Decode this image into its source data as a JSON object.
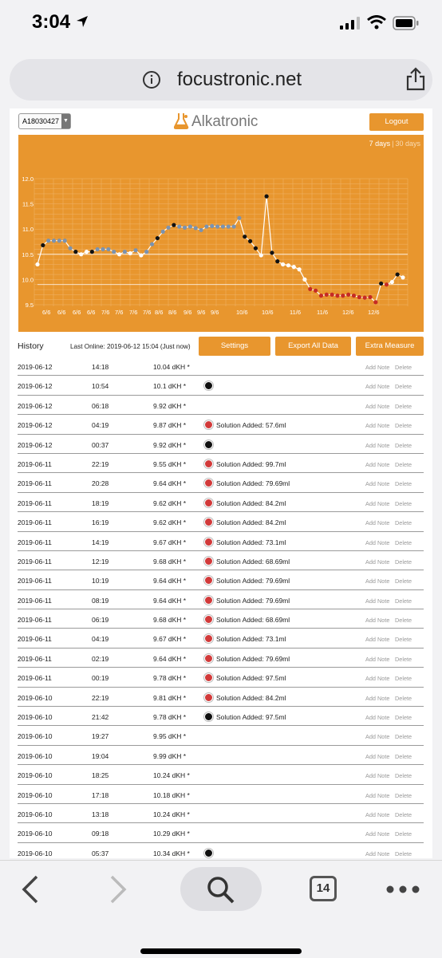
{
  "status_bar": {
    "time": "3:04"
  },
  "address_bar": {
    "url": "focustronic.net"
  },
  "header": {
    "device_id": "A18030427",
    "brand": "Alkatronic",
    "logout_label": "Logout"
  },
  "chart_data": {
    "type": "line",
    "range_options": [
      "7 days",
      "30 days"
    ],
    "selected_range": "7 days",
    "x_tick_labels": [
      "6/6",
      "6/6",
      "6/6",
      "6/6",
      "7/6",
      "7/6",
      "7/6",
      "7/6",
      "8/6",
      "8/6",
      "9/6",
      "9/6",
      "9/6",
      "10/6",
      "10/6",
      "11/6",
      "11/6",
      "12/6",
      "12/6"
    ],
    "ylim": [
      9.5,
      12.0
    ],
    "y_ticks": [
      9.5,
      10.0,
      10.5,
      11.0,
      11.5,
      12.0
    ],
    "values": [
      10.3,
      10.68,
      10.77,
      10.77,
      10.77,
      10.77,
      10.62,
      10.55,
      10.5,
      10.55,
      10.55,
      10.6,
      10.6,
      10.6,
      10.55,
      10.5,
      10.55,
      10.52,
      10.58,
      10.48,
      10.55,
      10.7,
      10.82,
      10.95,
      11.03,
      11.08,
      11.05,
      11.03,
      11.05,
      11.02,
      10.98,
      11.05,
      11.06,
      11.05,
      11.05,
      11.05,
      11.05,
      11.22,
      10.85,
      10.76,
      10.62,
      10.48,
      11.65,
      10.53,
      10.36,
      10.3,
      10.28,
      10.25,
      10.2,
      10.0,
      9.81,
      9.78,
      9.68,
      9.7,
      9.7,
      9.68,
      9.68,
      9.7,
      9.68,
      9.65,
      9.64,
      9.65,
      9.55,
      9.92,
      9.9,
      9.95,
      10.1,
      10.04
    ],
    "point_colors": [
      "white",
      "black",
      "blue",
      "blue",
      "blue",
      "blue",
      "blue",
      "black",
      "white",
      "white",
      "black",
      "blue",
      "blue",
      "blue",
      "blue",
      "white",
      "blue",
      "white",
      "blue",
      "white",
      "blue",
      "blue",
      "black",
      "blue",
      "blue",
      "black",
      "blue",
      "blue",
      "blue",
      "blue",
      "blue",
      "blue",
      "blue",
      "blue",
      "blue",
      "blue",
      "blue",
      "blue",
      "black",
      "black",
      "black",
      "white",
      "black",
      "black",
      "black",
      "white",
      "white",
      "white",
      "white",
      "white",
      "red",
      "red",
      "red",
      "red",
      "red",
      "red",
      "red",
      "red",
      "red",
      "red",
      "red",
      "red",
      "red",
      "black",
      "red",
      "white",
      "black",
      "white"
    ],
    "colors": {
      "background": "#e8962e",
      "line": "#ffffff",
      "blue": "#7b93b0",
      "black": "#111111",
      "white": "#ffffff",
      "red": "#c52b25"
    }
  },
  "history": {
    "title": "History",
    "last_online": "Last Online: 2019-06-12 15:04 (Just now)",
    "settings_label": "Settings",
    "export_label": "Export All Data",
    "extra_label": "Extra Measure",
    "add_note_label": "Add Note",
    "delete_label": "Delete",
    "rows": [
      {
        "date": "2019-06-12",
        "time": "14:18",
        "value": "10.04 dKH *",
        "dot": "",
        "note": ""
      },
      {
        "date": "2019-06-12",
        "time": "10:54",
        "value": "10.1 dKH *",
        "dot": "black",
        "note": ""
      },
      {
        "date": "2019-06-12",
        "time": "06:18",
        "value": "9.92 dKH *",
        "dot": "",
        "note": ""
      },
      {
        "date": "2019-06-12",
        "time": "04:19",
        "value": "9.87 dKH *",
        "dot": "red",
        "note": "Solution Added: 57.6ml"
      },
      {
        "date": "2019-06-12",
        "time": "00:37",
        "value": "9.92 dKH *",
        "dot": "black",
        "note": ""
      },
      {
        "date": "2019-06-11",
        "time": "22:19",
        "value": "9.55 dKH *",
        "dot": "red",
        "note": "Solution Added: 99.7ml"
      },
      {
        "date": "2019-06-11",
        "time": "20:28",
        "value": "9.64 dKH *",
        "dot": "red",
        "note": "Solution Added: 79.69ml"
      },
      {
        "date": "2019-06-11",
        "time": "18:19",
        "value": "9.62 dKH *",
        "dot": "red",
        "note": "Solution Added: 84.2ml"
      },
      {
        "date": "2019-06-11",
        "time": "16:19",
        "value": "9.62 dKH *",
        "dot": "red",
        "note": "Solution Added: 84.2ml"
      },
      {
        "date": "2019-06-11",
        "time": "14:19",
        "value": "9.67 dKH *",
        "dot": "red",
        "note": "Solution Added: 73.1ml"
      },
      {
        "date": "2019-06-11",
        "time": "12:19",
        "value": "9.68 dKH *",
        "dot": "red",
        "note": "Solution Added: 68.69ml"
      },
      {
        "date": "2019-06-11",
        "time": "10:19",
        "value": "9.64 dKH *",
        "dot": "red",
        "note": "Solution Added: 79.69ml"
      },
      {
        "date": "2019-06-11",
        "time": "08:19",
        "value": "9.64 dKH *",
        "dot": "red",
        "note": "Solution Added: 79.69ml"
      },
      {
        "date": "2019-06-11",
        "time": "06:19",
        "value": "9.68 dKH *",
        "dot": "red",
        "note": "Solution Added: 68.69ml"
      },
      {
        "date": "2019-06-11",
        "time": "04:19",
        "value": "9.67 dKH *",
        "dot": "red",
        "note": "Solution Added: 73.1ml"
      },
      {
        "date": "2019-06-11",
        "time": "02:19",
        "value": "9.64 dKH *",
        "dot": "red",
        "note": "Solution Added: 79.69ml"
      },
      {
        "date": "2019-06-11",
        "time": "00:19",
        "value": "9.78 dKH *",
        "dot": "red",
        "note": "Solution Added: 97.5ml"
      },
      {
        "date": "2019-06-10",
        "time": "22:19",
        "value": "9.81 dKH *",
        "dot": "red",
        "note": "Solution Added: 84.2ml"
      },
      {
        "date": "2019-06-10",
        "time": "21:42",
        "value": "9.78 dKH *",
        "dot": "black",
        "note": "Solution Added: 97.5ml"
      },
      {
        "date": "2019-06-10",
        "time": "19:27",
        "value": "9.95 dKH *",
        "dot": "",
        "note": ""
      },
      {
        "date": "2019-06-10",
        "time": "19:04",
        "value": "9.99 dKH *",
        "dot": "",
        "note": ""
      },
      {
        "date": "2019-06-10",
        "time": "18:25",
        "value": "10.24 dKH *",
        "dot": "",
        "note": ""
      },
      {
        "date": "2019-06-10",
        "time": "17:18",
        "value": "10.18 dKH *",
        "dot": "",
        "note": ""
      },
      {
        "date": "2019-06-10",
        "time": "13:18",
        "value": "10.24 dKH *",
        "dot": "",
        "note": ""
      },
      {
        "date": "2019-06-10",
        "time": "09:18",
        "value": "10.29 dKH *",
        "dot": "",
        "note": ""
      },
      {
        "date": "2019-06-10",
        "time": "05:37",
        "value": "10.34 dKH *",
        "dot": "black",
        "note": ""
      }
    ]
  },
  "toolbar": {
    "tab_count": "14"
  }
}
